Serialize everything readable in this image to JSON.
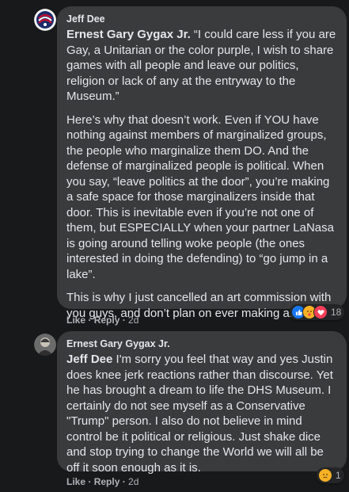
{
  "comments": [
    {
      "author": "Jeff Dee",
      "mention": "Ernest Gary Gygax Jr.",
      "quote": " “I could care less if you are Gay, a Unitarian or the color purple, I wish to share games with all people and leave our politics, religion or lack of any at the entryway to the Museum.”",
      "paragraphs": [
        "Here’s why that doesn’t work. Even if YOU have nothing against members of marginalized groups, the people who marginalize them DO. And the defense of marginalized people is political. When you say, “leave politics at the door”, you’re making a safe space for those marginalizers inside that door. This is inevitable even if you’re not one of them, but ESPECIALLY when your partner LaNasa is going around telling woke people (the ones interested in doing the defending) to “go jump in a lake”.",
        "This is why I just cancelled an art commission with you guys, and don’t plan on ever making another."
      ],
      "like_label": "Like",
      "reply_label": "Reply",
      "time": "2d",
      "reaction_count": "18",
      "reaction_icons": [
        "like-icon",
        "care-icon",
        "love-icon"
      ]
    },
    {
      "author": "Ernest Gary Gygax Jr.",
      "mention": "Jeff Dee",
      "text": " I'm sorry you feel that way and yes Justin does knee jerk reactions rather than discourse. Yet he has brought a dream to life the DHS Museum. I certainly do not see myself as a Conservative \"Trump\" person. I also do not believe in mind control be it political or religious. Just shake dice and stop trying to change the World we will all be off it soon enough as it is.",
      "like_label": "Like",
      "reply_label": "Reply",
      "time": "2d",
      "reaction_count": "1",
      "reaction_icons": [
        "sad-icon"
      ]
    }
  ],
  "separator": " · ",
  "colors": {
    "bg": "#18191a",
    "bubble": "#3a3b3c",
    "text": "#e4e6eb",
    "muted": "#b0b3b8",
    "like": "#1877f2",
    "love": "#f33e58",
    "care": "#f7b125"
  }
}
